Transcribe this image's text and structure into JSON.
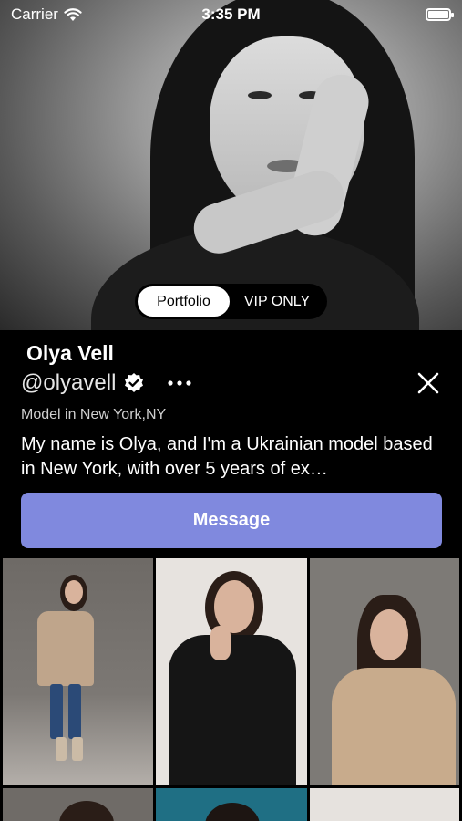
{
  "status_bar": {
    "carrier": "Carrier",
    "time": "3:35 PM"
  },
  "hero": {
    "tabs": [
      "Portfolio",
      "VIP ONLY"
    ],
    "selected_tab": "Portfolio"
  },
  "profile": {
    "name": "Olya Vell",
    "handle": "@olyavell",
    "subtitle": "Model in New York,NY",
    "bio": "My name is Olya, and I'm a Ukrainian model based in New York, with over 5 years of ex…",
    "message_label": "Message"
  },
  "colors": {
    "accent": "#8089de",
    "background": "#000000",
    "text": "#ffffff"
  },
  "icons": [
    "wifi-icon",
    "battery-icon",
    "verified-badge-icon",
    "more-icon",
    "close-icon"
  ]
}
